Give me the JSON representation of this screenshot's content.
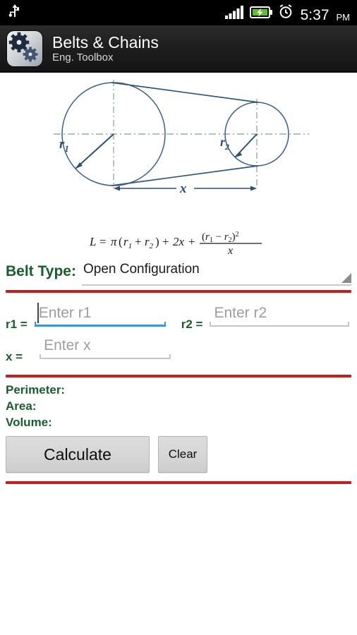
{
  "status_bar": {
    "usb_icon": "usb-icon",
    "signal_icon": "signal-bars-icon",
    "battery_icon": "battery-charging-icon",
    "alarm_icon": "alarm-clock-icon",
    "time": "5:37",
    "ampm": "PM"
  },
  "action_bar": {
    "icon": "gears-app-icon",
    "title": "Belts & Chains",
    "subtitle": "Eng. Toolbox"
  },
  "diagram": {
    "name": "open-belt-configuration-diagram",
    "label_r1": "r",
    "label_r1_sub": "1",
    "label_r2": "r",
    "label_r2_sub": "2",
    "label_x": "x",
    "stroke_color": "#33557a",
    "centerline_color": "#9aa7b8"
  },
  "formula": {
    "text": "L = π(r₁ + r₂) + 2x + (r₁ − r₂)² / x",
    "lhs": "L",
    "equals": "=",
    "pi": "π",
    "open_paren": "(",
    "r1": "r",
    "r1_sub": "1",
    "plus": "+",
    "r2": "r",
    "r2_sub": "2",
    "close_paren": ")",
    "two_x": "2x",
    "num_open": "(",
    "minus": "−",
    "num_close": ")",
    "exponent": "2",
    "denominator": "x"
  },
  "belt_type": {
    "label": "Belt Type:",
    "selected": "Open Configuration",
    "options": [
      "Open Configuration"
    ],
    "caret_icon": "spinner-caret-icon"
  },
  "inputs": [
    {
      "label": "r1 =",
      "placeholder": "Enter r1",
      "value": "",
      "focused": true,
      "name": "r1-input"
    },
    {
      "label": "r2 =",
      "placeholder": "Enter r2",
      "value": "",
      "focused": false,
      "name": "r2-input"
    },
    {
      "label": "x =",
      "placeholder": "Enter x",
      "value": "",
      "focused": false,
      "name": "x-input"
    }
  ],
  "results": [
    {
      "label": "Perimeter:",
      "value": ""
    },
    {
      "label": "Area:",
      "value": ""
    },
    {
      "label": "Volume:",
      "value": ""
    }
  ],
  "buttons": {
    "calculate": "Calculate",
    "clear": "Clear"
  },
  "colors": {
    "accent_green": "#1a5c2e",
    "divider_red": "#c41f1f",
    "focus_blue": "#3b93d9",
    "status_bar_bg": "#000000",
    "action_bar_bg": "#1d1d1d",
    "battery_green": "#5ec12e"
  }
}
